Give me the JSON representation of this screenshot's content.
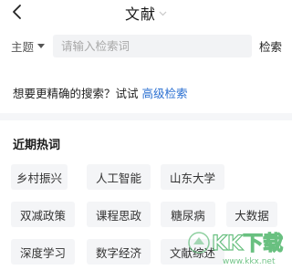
{
  "nav": {
    "title": "文献",
    "back_icon": "chevron-left-icon",
    "caret_icon": "chevron-down-icon"
  },
  "search": {
    "topic_label": "主题",
    "placeholder": "请输入检索词",
    "button_label": "检索"
  },
  "hint": {
    "text": "想要更精确的搜索？试试 ",
    "link": "高级检索"
  },
  "hot": {
    "title": "近期热词",
    "words": [
      "乡村振兴",
      "人工智能",
      "山东大学",
      "双减政策",
      "课程思政",
      "糖尿病",
      "大数据",
      "深度学习",
      "数字经济",
      "文献综述"
    ]
  },
  "watermark": {
    "text": "KK下载",
    "url": "www.kkx.net"
  },
  "colors": {
    "accent": "#2a6fd1",
    "chip_bg": "#f4f5f7",
    "input_bg": "#f2f3f5",
    "watermark": "#2fa84f"
  }
}
